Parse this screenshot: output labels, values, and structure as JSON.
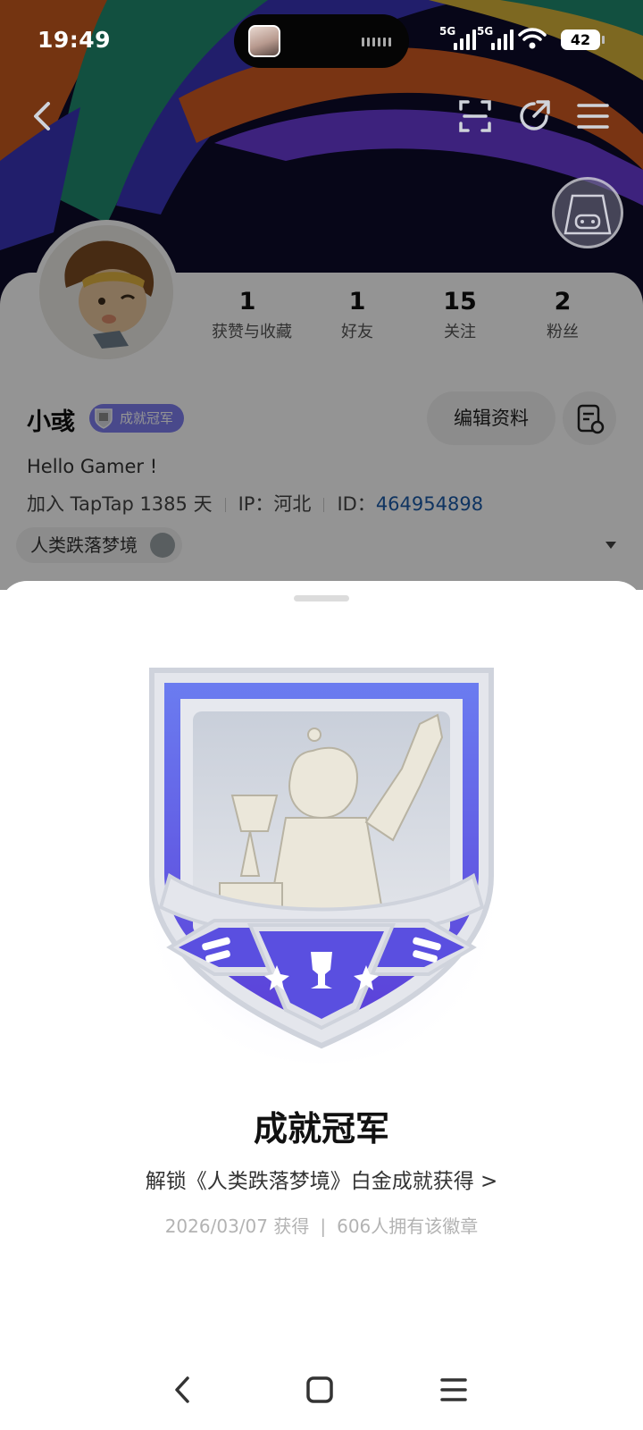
{
  "status_bar": {
    "time": "19:49",
    "network_1": "5G",
    "network_2": "5G",
    "battery": "42"
  },
  "header": {
    "back_icon": "chevron-left-icon",
    "scan_icon": "scan-icon",
    "share_icon": "share-icon",
    "menu_icon": "menu-icon"
  },
  "profile": {
    "stats": [
      {
        "value": "1",
        "label": "获赞与收藏"
      },
      {
        "value": "1",
        "label": "好友"
      },
      {
        "value": "15",
        "label": "关注"
      },
      {
        "value": "2",
        "label": "粉丝"
      }
    ],
    "username": "小彧",
    "badge_label": "成就冠军",
    "edit_label": "编辑资料",
    "bio": "Hello Gamer !",
    "join_text": "加入 TapTap 1385 天",
    "ip_text": "IP：河北",
    "id_label": "ID：",
    "id_value": "464954898",
    "game_name": "人类跌落梦境"
  },
  "badge_sheet": {
    "title": "成就冠军",
    "description": "解锁《人类跌落梦境》白金成就获得 >",
    "obtained": "2026/03/07 获得",
    "owners": "606人拥有该徽章",
    "colors": {
      "accent": "#5a55e0",
      "frame": "#d9dbe3"
    }
  },
  "nav": {
    "back_icon": "nav-back-icon",
    "home_icon": "nav-home-icon",
    "menu_icon": "nav-menu-icon"
  }
}
